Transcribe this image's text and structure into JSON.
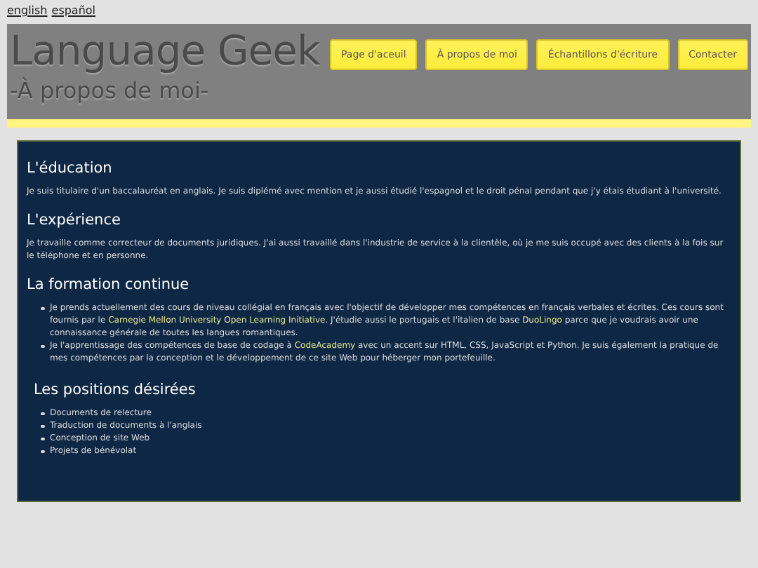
{
  "language_links": [
    "english",
    "español"
  ],
  "header": {
    "title": "Language Geek",
    "subtitle": "-À propos de moi-"
  },
  "nav": [
    {
      "label": "Page d'aceuil"
    },
    {
      "label": "À propos de moi"
    },
    {
      "label": "Échantillons d'écriture"
    },
    {
      "label": "Contacter"
    }
  ],
  "sections": [
    {
      "heading": "L'éducation",
      "kind": "paragraph",
      "parts": [
        {
          "text": "Je suis titulaire d'un baccalauréat en anglais. Je suis diplémé avec mention et je aussi étudié l'espagnol et le droit pénal pendant que j'y étais étudiant à l'université."
        }
      ]
    },
    {
      "heading": "L'expérience",
      "kind": "paragraph",
      "parts": [
        {
          "text": "Je travaille comme correcteur de documents juridiques. J'ai aussi travaillé dans l'industrie de service à la clientèle, où je me suis occupé avec des clients à la fois sur le téléphone et en personne."
        }
      ]
    },
    {
      "heading": "La formation continue",
      "kind": "list",
      "items": [
        [
          {
            "text": "Je prends actuellement des cours de niveau collégial en français avec l'objectif de développer mes compétences en français verbales et écrites. Ces cours sont fournis par le "
          },
          {
            "link": "Carnegie Mellon University Open Learning Initiative"
          },
          {
            "text": ". J'étudie aussi le portugais et l'italien de base "
          },
          {
            "link": "DuoLingo"
          },
          {
            "text": " parce que je voudrais avoir une connaissance générale de toutes les langues romantiques."
          }
        ],
        [
          {
            "text": "Je l'apprentissage des compétences de base de codage à "
          },
          {
            "link": "CodeAcademy"
          },
          {
            "text": " avec un accent sur HTML, CSS, JavaScript et Python. Je suis également la pratique de mes compétences par la conception et le développement de ce site Web pour héberger mon portefeuille."
          }
        ]
      ]
    },
    {
      "heading": "Les positions désirées",
      "kind": "list",
      "items": [
        [
          {
            "text": "Documents de relecture"
          }
        ],
        [
          {
            "text": "Traduction de documents à l'anglais"
          }
        ],
        [
          {
            "text": "Conception de site Web"
          }
        ],
        [
          {
            "text": "Projets de bénévolat"
          }
        ]
      ]
    }
  ]
}
